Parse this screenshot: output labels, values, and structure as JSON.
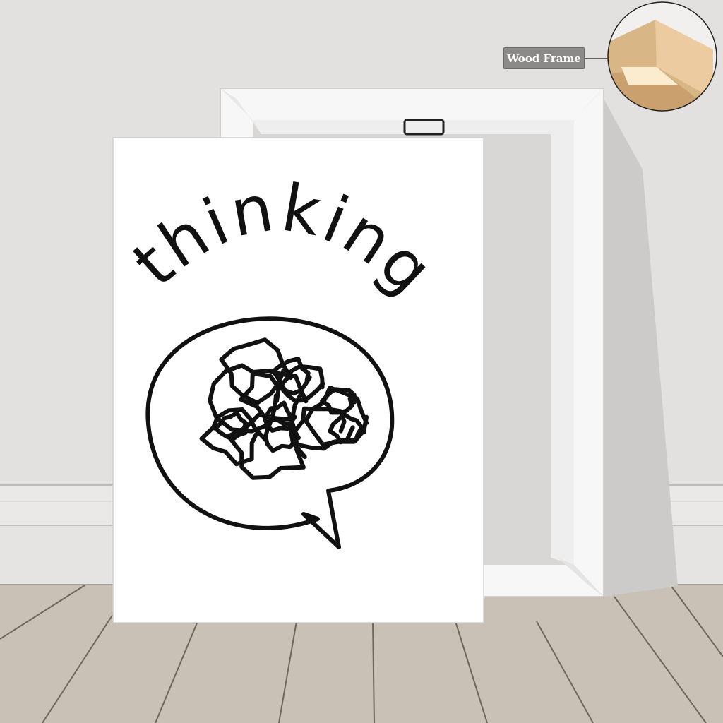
{
  "artwork": {
    "title_text": "thinking"
  },
  "callout": {
    "label": "Wood Frame"
  },
  "colors": {
    "wall": "#e3e1df",
    "baseboard": "#eceae8",
    "floor": "#c9c0b6",
    "canvas": "#ffffff",
    "ink": "#111111",
    "wood": "#e2c092"
  }
}
